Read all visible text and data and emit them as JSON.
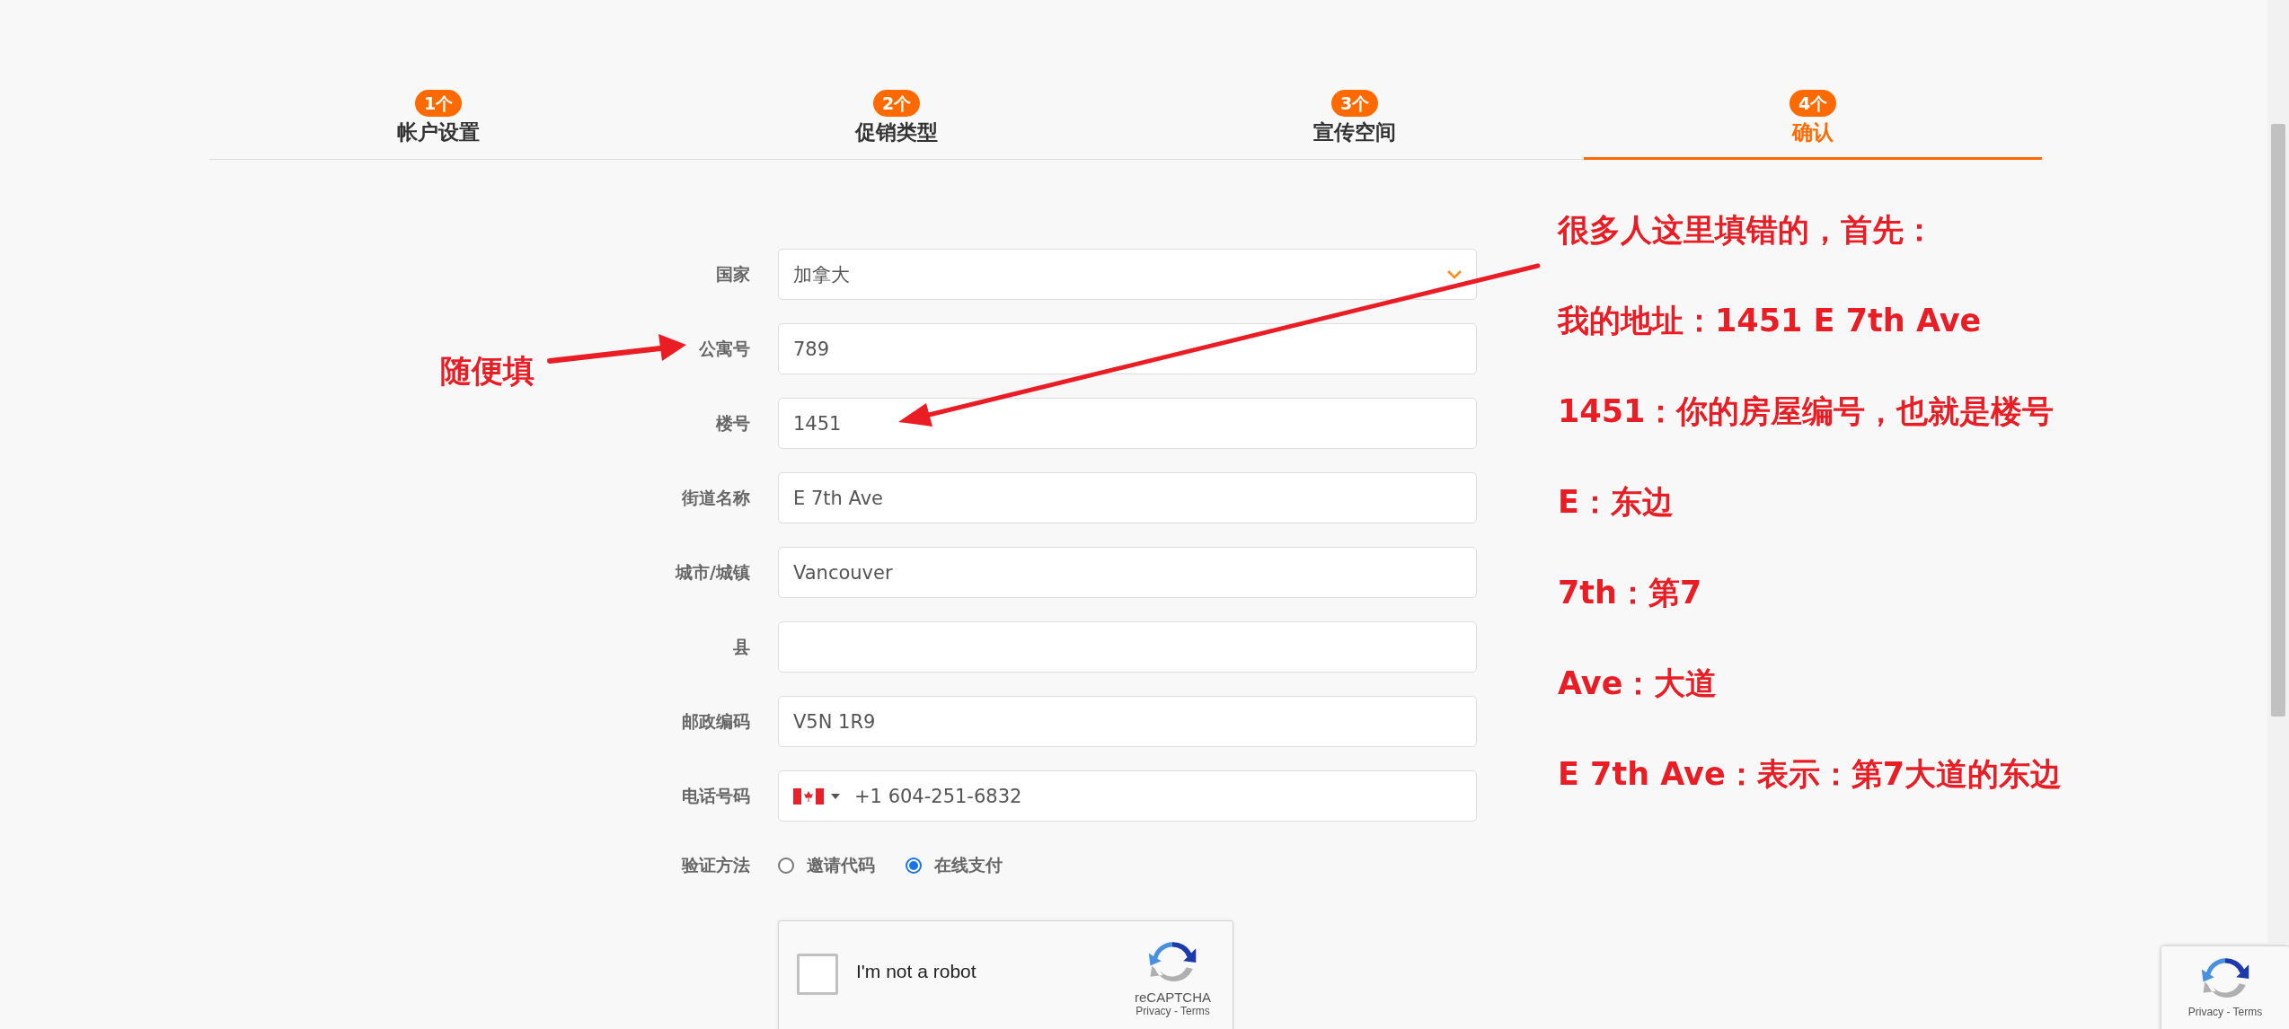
{
  "tabs": [
    {
      "badge": "1个",
      "label": "帐户设置",
      "selected": false
    },
    {
      "badge": "2个",
      "label": "促销类型",
      "selected": false
    },
    {
      "badge": "3个",
      "label": "宣传空间",
      "selected": false
    },
    {
      "badge": "4个",
      "label": "确认",
      "selected": true
    }
  ],
  "form": {
    "fields": [
      {
        "kind": "select",
        "label": "国家",
        "value": "加拿大"
      },
      {
        "kind": "text",
        "label": "公寓号",
        "value": "789"
      },
      {
        "kind": "text",
        "label": "楼号",
        "value": "1451"
      },
      {
        "kind": "text",
        "label": "街道名称",
        "value": "E 7th Ave"
      },
      {
        "kind": "text",
        "label": "城市/城镇",
        "value": "Vancouver"
      },
      {
        "kind": "text",
        "label": "县"
      },
      {
        "kind": "text",
        "label": "邮政编码",
        "value": "V5N 1R9"
      },
      {
        "kind": "phone",
        "label": "电话号码",
        "value": "+1 604-251-6832"
      }
    ],
    "verification": {
      "label": "验证方法",
      "options": [
        {
          "label": "邀请代码",
          "selected": false
        },
        {
          "label": "在线支付",
          "selected": true
        }
      ]
    },
    "captcha": {
      "label": "I'm not a robot",
      "checked": false,
      "brand": "reCAPTCHA",
      "links": "Privacy - Terms"
    }
  },
  "annotations": {
    "left_note": "随便填",
    "right_notes": [
      "很多人这里填错的，首先：",
      "我的地址：1451 E 7th Ave",
      "1451：你的房屋编号，也就是楼号",
      "E：东边",
      "7th：第7",
      "Ave：大道",
      "E 7th Ave：表示：第7大道的东边"
    ]
  },
  "recaptcha_badge": {
    "links": "Privacy - Terms"
  }
}
